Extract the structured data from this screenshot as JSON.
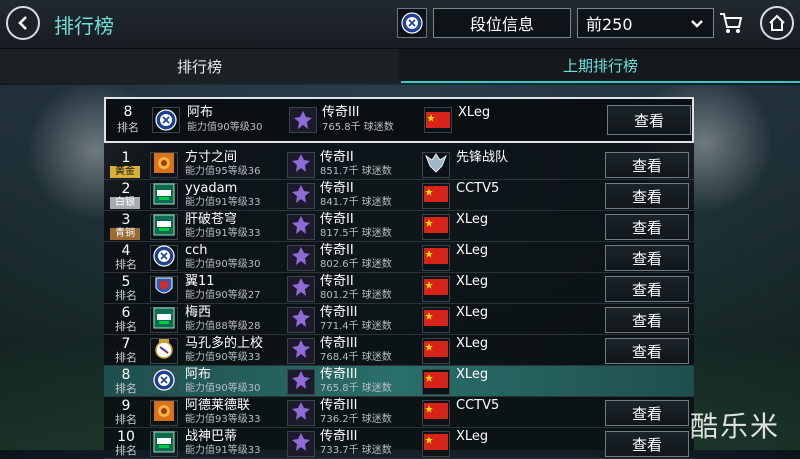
{
  "header": {
    "title": "排行榜",
    "rank_info_label": "段位信息",
    "range_value": "前250"
  },
  "tabs": [
    {
      "label": "排行榜",
      "active": false
    },
    {
      "label": "上期排行榜",
      "active": true
    }
  ],
  "my_rank": {
    "rank": "8",
    "rank_label": "排名",
    "name": "阿布",
    "stats": "能力值90等级30",
    "division": "传奇III",
    "fans": "765.8千 球迷数",
    "team": "XLeg",
    "view_label": "查看",
    "avatar": "chelsea-badge-icon",
    "flag": "china-flag-icon"
  },
  "rows": [
    {
      "rank": "1",
      "rank_label": "黄金",
      "medal": "gold",
      "name": "方寸之间",
      "stats": "能力值95等级36",
      "division": "传奇II",
      "fans": "851.7千 球迷数",
      "team": "先锋战队",
      "view_label": "查看",
      "avatar": "orange-emblem-icon",
      "flag": "dragon-emblem-icon"
    },
    {
      "rank": "2",
      "rank_label": "白银",
      "medal": "silver",
      "name": "yyadam",
      "stats": "能力值91等级33",
      "division": "传奇II",
      "fans": "841.7千 球迷数",
      "team": "CCTV5",
      "view_label": "查看",
      "avatar": "fifa-badge-icon",
      "flag": "china-flag-icon"
    },
    {
      "rank": "3",
      "rank_label": "青铜",
      "medal": "bronze",
      "name": "肝破苍穹",
      "stats": "能力值91等级33",
      "division": "传奇II",
      "fans": "817.5千 球迷数",
      "team": "XLeg",
      "view_label": "查看",
      "avatar": "fifa-badge-icon",
      "flag": "china-flag-icon"
    },
    {
      "rank": "4",
      "rank_label": "排名",
      "medal": "",
      "name": "cch",
      "stats": "能力值90等级30",
      "division": "传奇II",
      "fans": "802.6千 球迷数",
      "team": "XLeg",
      "view_label": "查看",
      "avatar": "chelsea-badge-icon",
      "flag": "china-flag-icon"
    },
    {
      "rank": "5",
      "rank_label": "排名",
      "medal": "",
      "name": "翼11",
      "stats": "能力值90等级27",
      "division": "传奇II",
      "fans": "801.2千 球迷数",
      "team": "XLeg",
      "view_label": "查看",
      "avatar": "blue-red-crest-icon",
      "flag": "china-flag-icon"
    },
    {
      "rank": "6",
      "rank_label": "排名",
      "medal": "",
      "name": "梅西",
      "stats": "能力值88等级28",
      "division": "传奇III",
      "fans": "771.4千 球迷数",
      "team": "XLeg",
      "view_label": "查看",
      "avatar": "fifa-badge-icon",
      "flag": "china-flag-icon"
    },
    {
      "rank": "7",
      "rank_label": "排名",
      "medal": "",
      "name": "马孔多的上校",
      "stats": "能力值90等级33",
      "division": "传奇III",
      "fans": "768.4千 球迷数",
      "team": "XLeg",
      "view_label": "查看",
      "avatar": "real-madrid-crest-icon",
      "flag": "china-flag-icon"
    },
    {
      "rank": "8",
      "rank_label": "排名",
      "medal": "",
      "name": "阿布",
      "stats": "能力值90等级30",
      "division": "传奇III",
      "fans": "765.8千 球迷数",
      "team": "XLeg",
      "view_label": "",
      "avatar": "chelsea-badge-icon",
      "flag": "china-flag-icon",
      "highlight": true
    },
    {
      "rank": "9",
      "rank_label": "排名",
      "medal": "",
      "name": "阿德莱德联",
      "stats": "能力值93等级33",
      "division": "传奇III",
      "fans": "736.2千 球迷数",
      "team": "CCTV5",
      "view_label": "查看",
      "avatar": "orange-emblem-icon",
      "flag": "china-flag-icon"
    },
    {
      "rank": "10",
      "rank_label": "排名",
      "medal": "",
      "name": "战神巴蒂",
      "stats": "能力值91等级33",
      "division": "传奇III",
      "fans": "733.7千 球迷数",
      "team": "XLeg",
      "view_label": "查看",
      "avatar": "fifa-badge-icon",
      "flag": "china-flag-icon"
    }
  ],
  "watermark": "酷乐米",
  "colors": {
    "accent": "#6fe0d8",
    "highlight": "#2a6e6a",
    "flag_red": "#d8231b",
    "flag_star": "#ffde00"
  }
}
